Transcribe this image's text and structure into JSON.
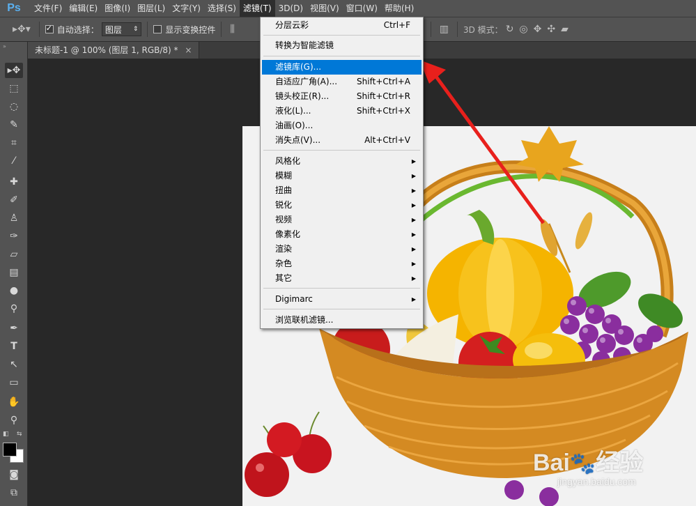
{
  "app": {
    "logo": "Ps"
  },
  "menubar": {
    "items": [
      "文件(F)",
      "编辑(E)",
      "图像(I)",
      "图层(L)",
      "文字(Y)",
      "选择(S)",
      "滤镜(T)",
      "3D(D)",
      "视图(V)",
      "窗口(W)",
      "帮助(H)"
    ]
  },
  "options": {
    "auto_select_label": "自动选择：",
    "auto_select_value": "图层",
    "show_transform_label": "显示变换控件",
    "mode_3d_label": "3D 模式："
  },
  "document": {
    "tab_title": "未标题-1 @ 100% (图层 1, RGB/8) *",
    "close": "×"
  },
  "filter_menu": {
    "items": [
      {
        "label": "分层云彩",
        "shortcut": "Ctrl+F"
      },
      {
        "label": "转换为智能滤镜",
        "shortcut": ""
      },
      {
        "label": "滤镜库(G)...",
        "shortcut": ""
      },
      {
        "label": "自适应广角(A)...",
        "shortcut": "Shift+Ctrl+A"
      },
      {
        "label": "镜头校正(R)...",
        "shortcut": "Shift+Ctrl+R"
      },
      {
        "label": "液化(L)...",
        "shortcut": "Shift+Ctrl+X"
      },
      {
        "label": "油画(O)...",
        "shortcut": ""
      },
      {
        "label": "消失点(V)...",
        "shortcut": "Alt+Ctrl+V"
      },
      {
        "label": "风格化",
        "shortcut": ""
      },
      {
        "label": "模糊",
        "shortcut": ""
      },
      {
        "label": "扭曲",
        "shortcut": ""
      },
      {
        "label": "锐化",
        "shortcut": ""
      },
      {
        "label": "视频",
        "shortcut": ""
      },
      {
        "label": "像素化",
        "shortcut": ""
      },
      {
        "label": "渲染",
        "shortcut": ""
      },
      {
        "label": "杂色",
        "shortcut": ""
      },
      {
        "label": "其它",
        "shortcut": ""
      },
      {
        "label": "Digimarc",
        "shortcut": ""
      },
      {
        "label": "浏览联机滤镜...",
        "shortcut": ""
      }
    ]
  },
  "watermark": {
    "brand": "Bai",
    "brand2": "经验",
    "url": "jingyan.baidu.com"
  },
  "colors": {
    "highlight": "#0078d7",
    "arrow": "#e8201c",
    "menubar": "#535353"
  }
}
